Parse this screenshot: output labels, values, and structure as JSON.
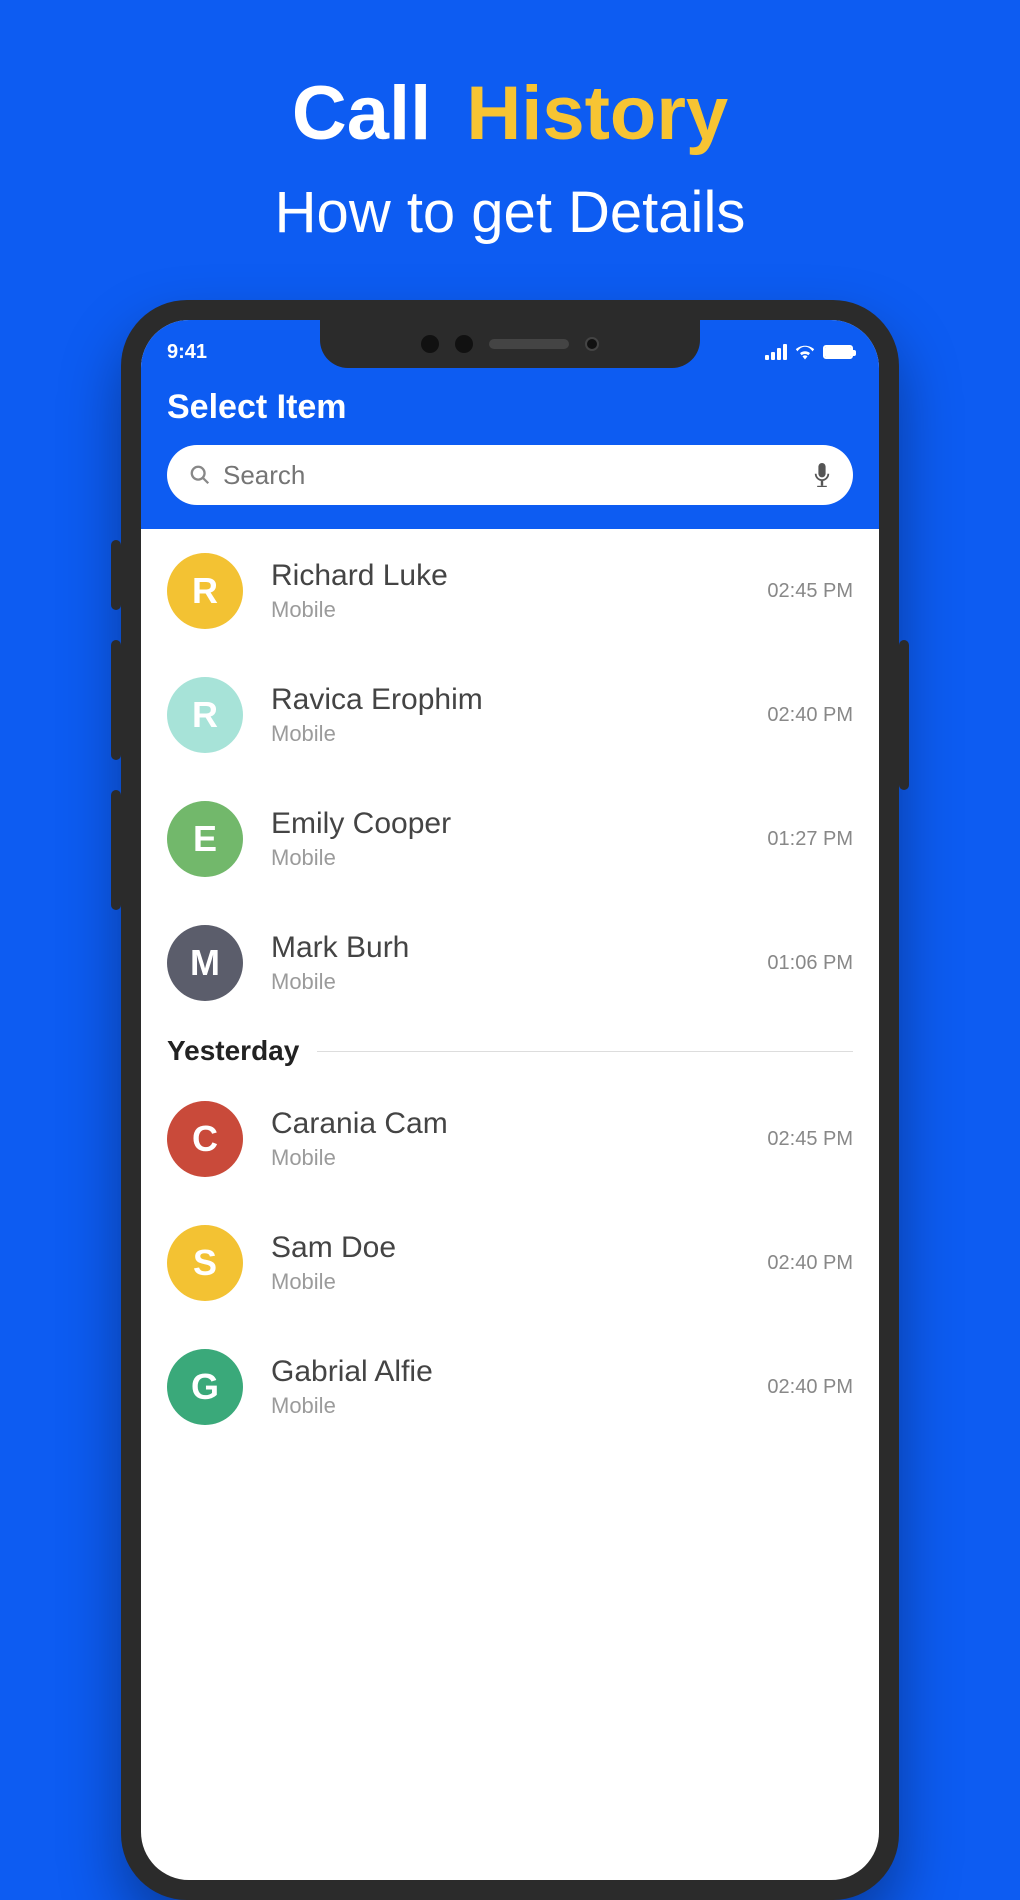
{
  "promo": {
    "title_word1": "Call",
    "title_word2": "History",
    "subtitle": "How to get Details"
  },
  "status": {
    "time": "9:41"
  },
  "header": {
    "title": "Select Item"
  },
  "search": {
    "placeholder": "Search"
  },
  "sections": [
    {
      "header": null,
      "items": [
        {
          "initial": "R",
          "color": "#f3c233",
          "name": "Richard Luke",
          "label": "Mobile",
          "time": "02:45 PM"
        },
        {
          "initial": "R",
          "color": "#a7e3d8",
          "name": "Ravica Erophim",
          "label": "Mobile",
          "time": "02:40 PM"
        },
        {
          "initial": "E",
          "color": "#72b86b",
          "name": "Emily Cooper",
          "label": "Mobile",
          "time": "01:27 PM"
        },
        {
          "initial": "M",
          "color": "#5b5d6b",
          "name": "Mark Burh",
          "label": "Mobile",
          "time": "01:06 PM"
        }
      ]
    },
    {
      "header": "Yesterday",
      "items": [
        {
          "initial": "C",
          "color": "#c94a3a",
          "name": "Carania Cam",
          "label": "Mobile",
          "time": "02:45 PM"
        },
        {
          "initial": "S",
          "color": "#f3c233",
          "name": "Sam Doe",
          "label": "Mobile",
          "time": "02:40 PM"
        },
        {
          "initial": "G",
          "color": "#3aa97a",
          "name": "Gabrial Alfie",
          "label": "Mobile",
          "time": "02:40 PM"
        }
      ]
    }
  ]
}
